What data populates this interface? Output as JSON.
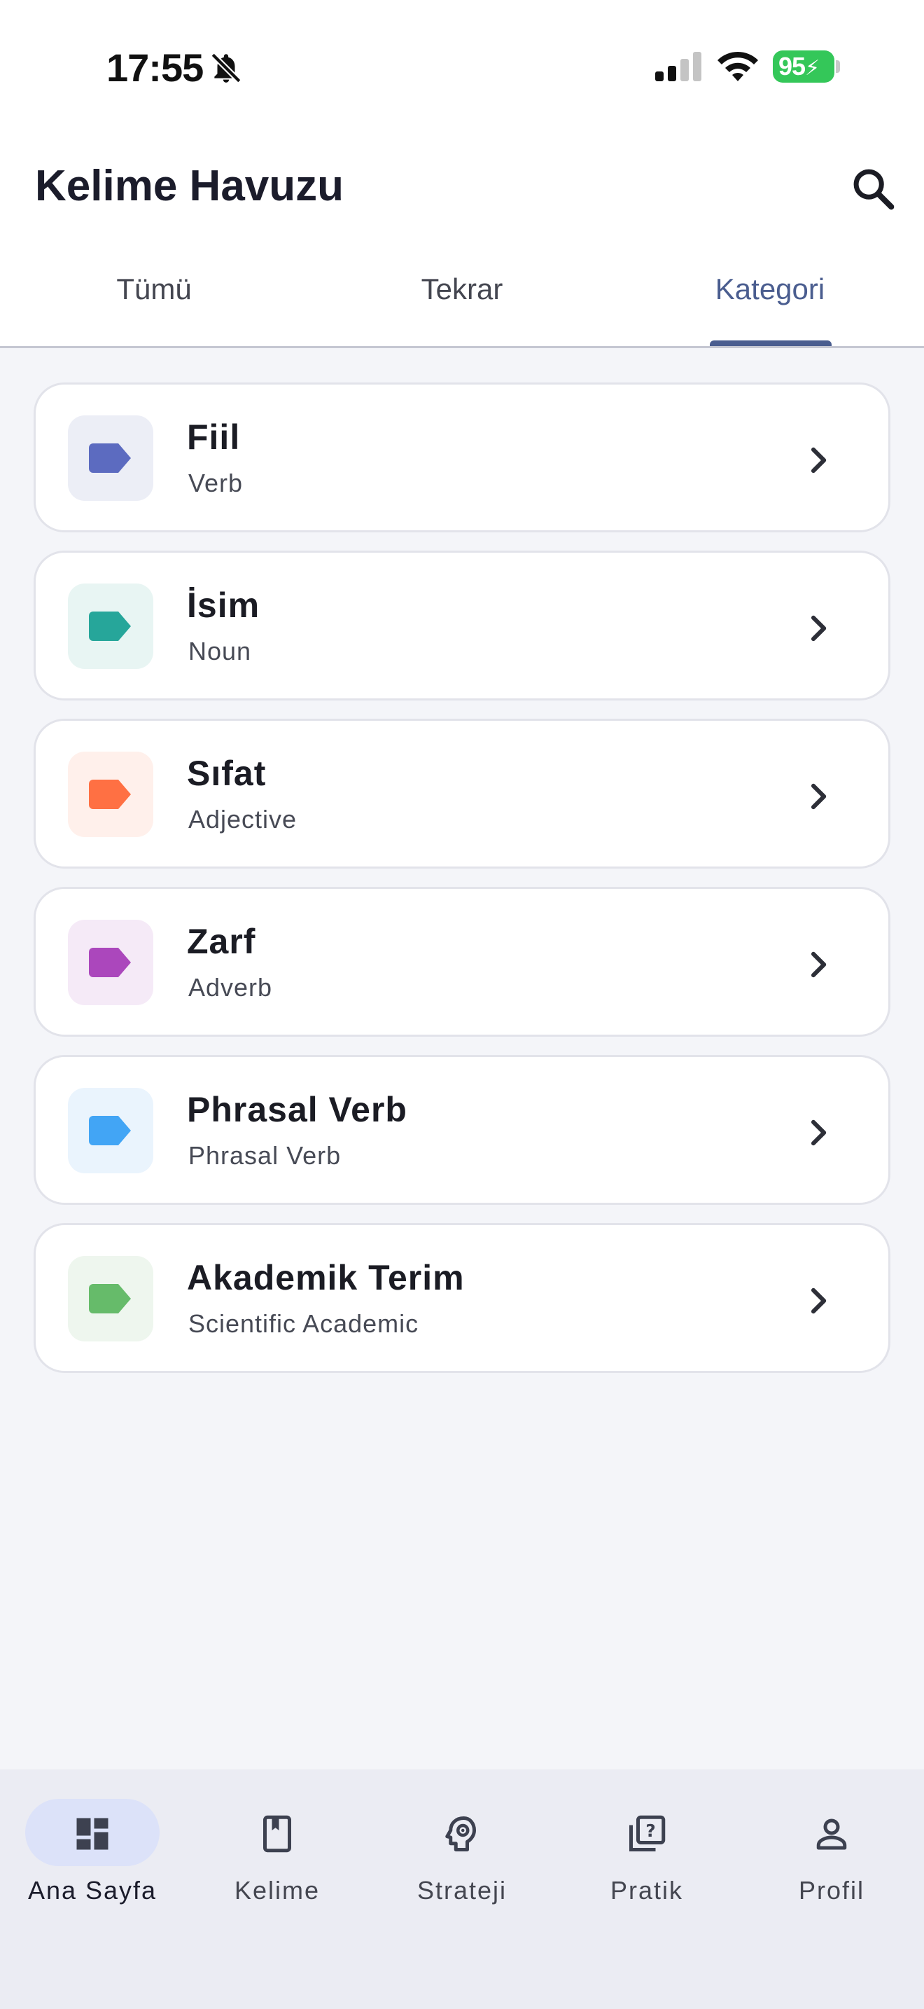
{
  "status_bar": {
    "time": "17:55",
    "battery": "95",
    "icons": [
      "bell-slash-icon",
      "signal-icon",
      "wifi-icon",
      "battery-charging-icon"
    ]
  },
  "header": {
    "title": "Kelime Havuzu",
    "search_icon": "search-icon"
  },
  "tabs": [
    {
      "label": "Tümü",
      "active": false
    },
    {
      "label": "Tekrar",
      "active": false
    },
    {
      "label": "Kategori",
      "active": true
    }
  ],
  "categories": [
    {
      "title": "Fiil",
      "subtitle": "Verb",
      "color": "#5c6bc0",
      "bg": "#eceef6",
      "icon": "tag-icon"
    },
    {
      "title": "İsim",
      "subtitle": "Noun",
      "color": "#26a69a",
      "bg": "#e8f5f3",
      "icon": "tag-icon"
    },
    {
      "title": "Sıfat",
      "subtitle": "Adjective",
      "color": "#ff7043",
      "bg": "#fff0eb",
      "icon": "tag-icon"
    },
    {
      "title": "Zarf",
      "subtitle": "Adverb",
      "color": "#ab47bc",
      "bg": "#f5eaf7",
      "icon": "tag-icon"
    },
    {
      "title": "Phrasal Verb",
      "subtitle": "Phrasal Verb",
      "color": "#42a5f5",
      "bg": "#eaf4fd",
      "icon": "tag-icon"
    },
    {
      "title": "Akademik Terim",
      "subtitle": "Scientific Academic",
      "color": "#66bb6a",
      "bg": "#eef6ee",
      "icon": "tag-icon"
    }
  ],
  "bottom_nav": [
    {
      "label": "Ana Sayfa",
      "icon": "dashboard-icon",
      "active": true
    },
    {
      "label": "Kelime",
      "icon": "book-bookmark-icon",
      "active": false
    },
    {
      "label": "Strateji",
      "icon": "brain-gear-icon",
      "active": false
    },
    {
      "label": "Pratik",
      "icon": "quiz-icon",
      "active": false
    },
    {
      "label": "Profil",
      "icon": "person-icon",
      "active": false
    }
  ],
  "colors": {
    "accent": "#4a5d8f",
    "background": "#f4f5f9",
    "nav_background": "#ebecf3",
    "nav_active_pill": "#dce2f9",
    "battery": "#34c759"
  }
}
